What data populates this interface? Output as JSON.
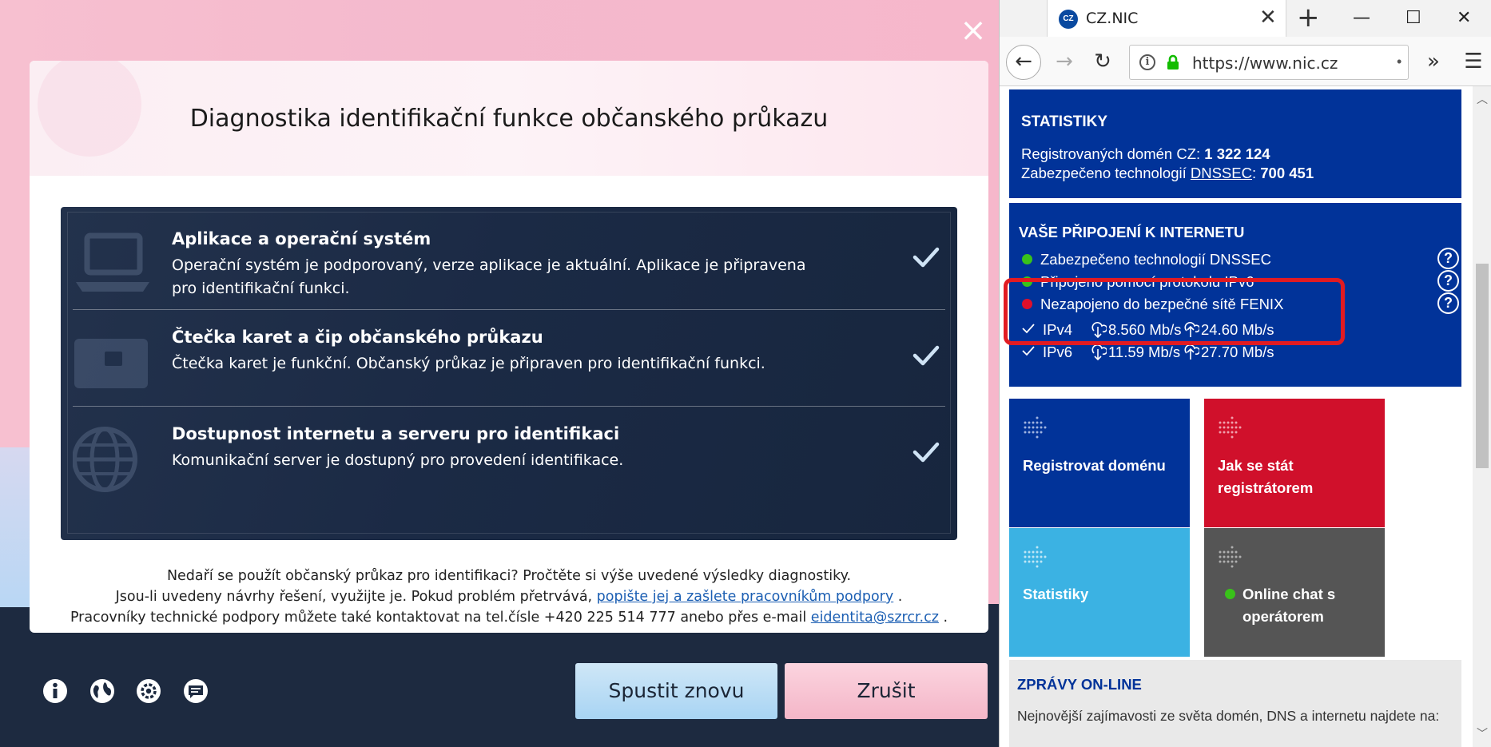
{
  "app": {
    "close_symbol": "×",
    "title": "Diagnostika identifikační funkce občanského průkazu",
    "results": [
      {
        "title": "Aplikace a operační systém",
        "desc": "Operační systém je podporovaný, verze aplikace je aktuální. Aplikace je připravena pro identifikační funkci.",
        "icon": "laptop-icon",
        "status": "ok"
      },
      {
        "title": "Čtečka karet a čip občanského průkazu",
        "desc": "Čtečka karet je funkční. Občanský průkaz je připraven pro identifikační funkci.",
        "icon": "id-card-icon",
        "status": "ok"
      },
      {
        "title": "Dostupnost internetu a serveru pro identifikaci",
        "desc": "Komunikační server je dostupný pro provedení identifikace.",
        "icon": "globe-icon",
        "status": "ok"
      }
    ],
    "help": {
      "line1": "Nedaří se použít občanský průkaz pro identifikaci? Pročtěte si výše uvedené výsledky diagnostiky.",
      "line2_before": "Jsou-li uvedeny návrhy řešení, využijte je. Pokud problém přetrvává, ",
      "line2_link": "popište jej a zašlete pracovníkům podpory",
      "line2_after": " .",
      "line3_before": "Pracovníky technické podpory můžete také kontaktovat na tel.čísle +420 225 514 777 anebo přes e-mail ",
      "line3_link": "eidentita@szrcr.cz",
      "line3_after": " ."
    },
    "buttons": {
      "rerun": "Spustit znovu",
      "cancel": "Zrušit"
    },
    "footer_icons": [
      "info-icon",
      "globe-icon",
      "settings-icon",
      "chat-icon"
    ]
  },
  "browser": {
    "tab": {
      "favicon": "CZ",
      "title": "CZ.NIC",
      "close": "✕"
    },
    "new_tab": "+",
    "window": {
      "minimize": "—",
      "maximize": "☐",
      "close": "✕"
    },
    "url": "https://www.nic.cz",
    "url_dots": "•",
    "overflow": "»",
    "menu": "☰",
    "back": "←",
    "forward": "→",
    "reload": "↻"
  },
  "site": {
    "stats": {
      "heading": "STATISTIKY",
      "registered_label": "Registrovaných domén CZ: ",
      "registered_value": "1 322 124",
      "secured_label": "Zabezpečeno technologií ",
      "secured_link": "DNSSEC",
      "secured_sep": ": ",
      "secured_value": "700 451"
    },
    "connection": {
      "heading": "VAŠE PŘIPOJENÍ K INTERNETU",
      "items": [
        {
          "label": "Zabezpečeno technologií DNSSEC",
          "status_color": "#39c21a"
        },
        {
          "label": "Připojeno pomocí protokolu IPv6",
          "status_color": "#39c21a"
        },
        {
          "label": "Nezapojeno do bezpečné sítě FENIX",
          "status_color": "#e0102b"
        }
      ],
      "help_symbol": "?",
      "speeds": [
        {
          "proto": "IPv4",
          "down": "8.560 Mb/s",
          "up": "24.60 Mb/s"
        },
        {
          "proto": "IPv6",
          "down": "11.59 Mb/s",
          "up": "27.70 Mb/s"
        }
      ]
    },
    "tiles": {
      "register": "Registrovat doménu",
      "registrar": "Jak se stát registrátorem",
      "statistics": "Statistiky",
      "chat": "Online chat s operátorem"
    },
    "news": {
      "heading": "ZPRÁVY ON-LINE",
      "text": "Nejnovější zajímavosti ze světa domén, DNS a internetu najdete na:"
    }
  },
  "colors": {
    "nic_blue": "#013399",
    "nic_red": "#d0102b",
    "nic_light_blue": "#3bb2e3",
    "nic_gray": "#555555",
    "highlight": "#e11b22",
    "app_dark": "#1d2a40"
  }
}
